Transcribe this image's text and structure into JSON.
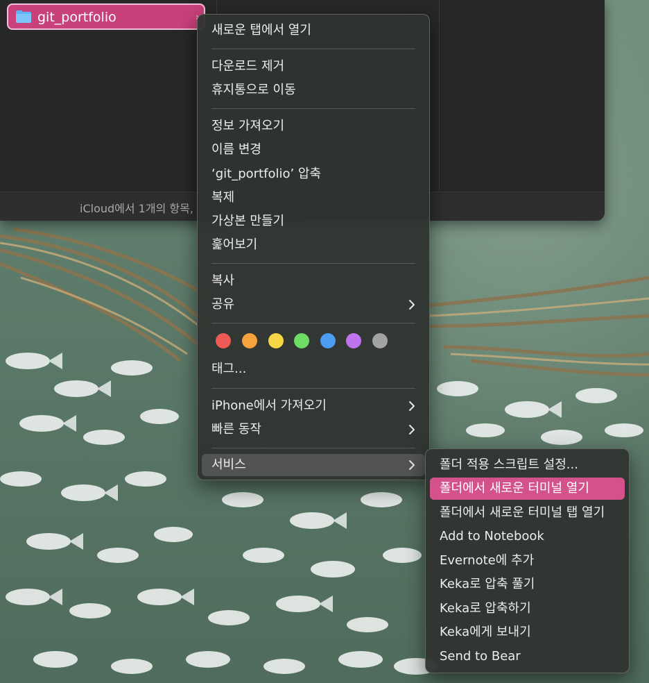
{
  "finder": {
    "folder_name": "git_portfolio",
    "status_text": "iCloud에서 1개의 항목,"
  },
  "context_menu": {
    "open_new_tab": "새로운 탭에서 열기",
    "remove_download": "다운로드 제거",
    "move_to_trash": "휴지통으로 이동",
    "get_info": "정보 가져오기",
    "rename": "이름 변경",
    "compress": "‘git_portfolio’ 압축",
    "duplicate": "복제",
    "make_alias": "가상본 만들기",
    "quick_look": "훑어보기",
    "copy": "복사",
    "share": "공유",
    "tags": "태그...",
    "import_from_iphone": "iPhone에서 가져오기",
    "quick_actions": "빠른 동작",
    "services": "서비스"
  },
  "tag_colors": {
    "red": "#ee5b57",
    "orange": "#f5a43c",
    "yellow": "#f6d645",
    "green": "#6fdc63",
    "blue": "#4a9df0",
    "purple": "#be73ef",
    "gray": "#a3a3a3"
  },
  "services_menu": {
    "folder_actions_setup": "폴더 적용 스크립트 설정...",
    "new_terminal_at_folder": "폴더에서 새로운 터미널 열기",
    "new_terminal_tab_at_folder": "폴더에서 새로운 터미널 탭 열기",
    "add_to_notebook": "Add to Notebook",
    "add_to_evernote": "Evernote에 추가",
    "keka_extract": "Keka로 압축 풀기",
    "keka_compress": "Keka로 압축하기",
    "send_to_keka": "Keka에게 보내기",
    "send_to_bear": "Send to Bear"
  },
  "colors": {
    "selection_pink": "#c8417a",
    "menu_highlight": "#d4528c"
  }
}
